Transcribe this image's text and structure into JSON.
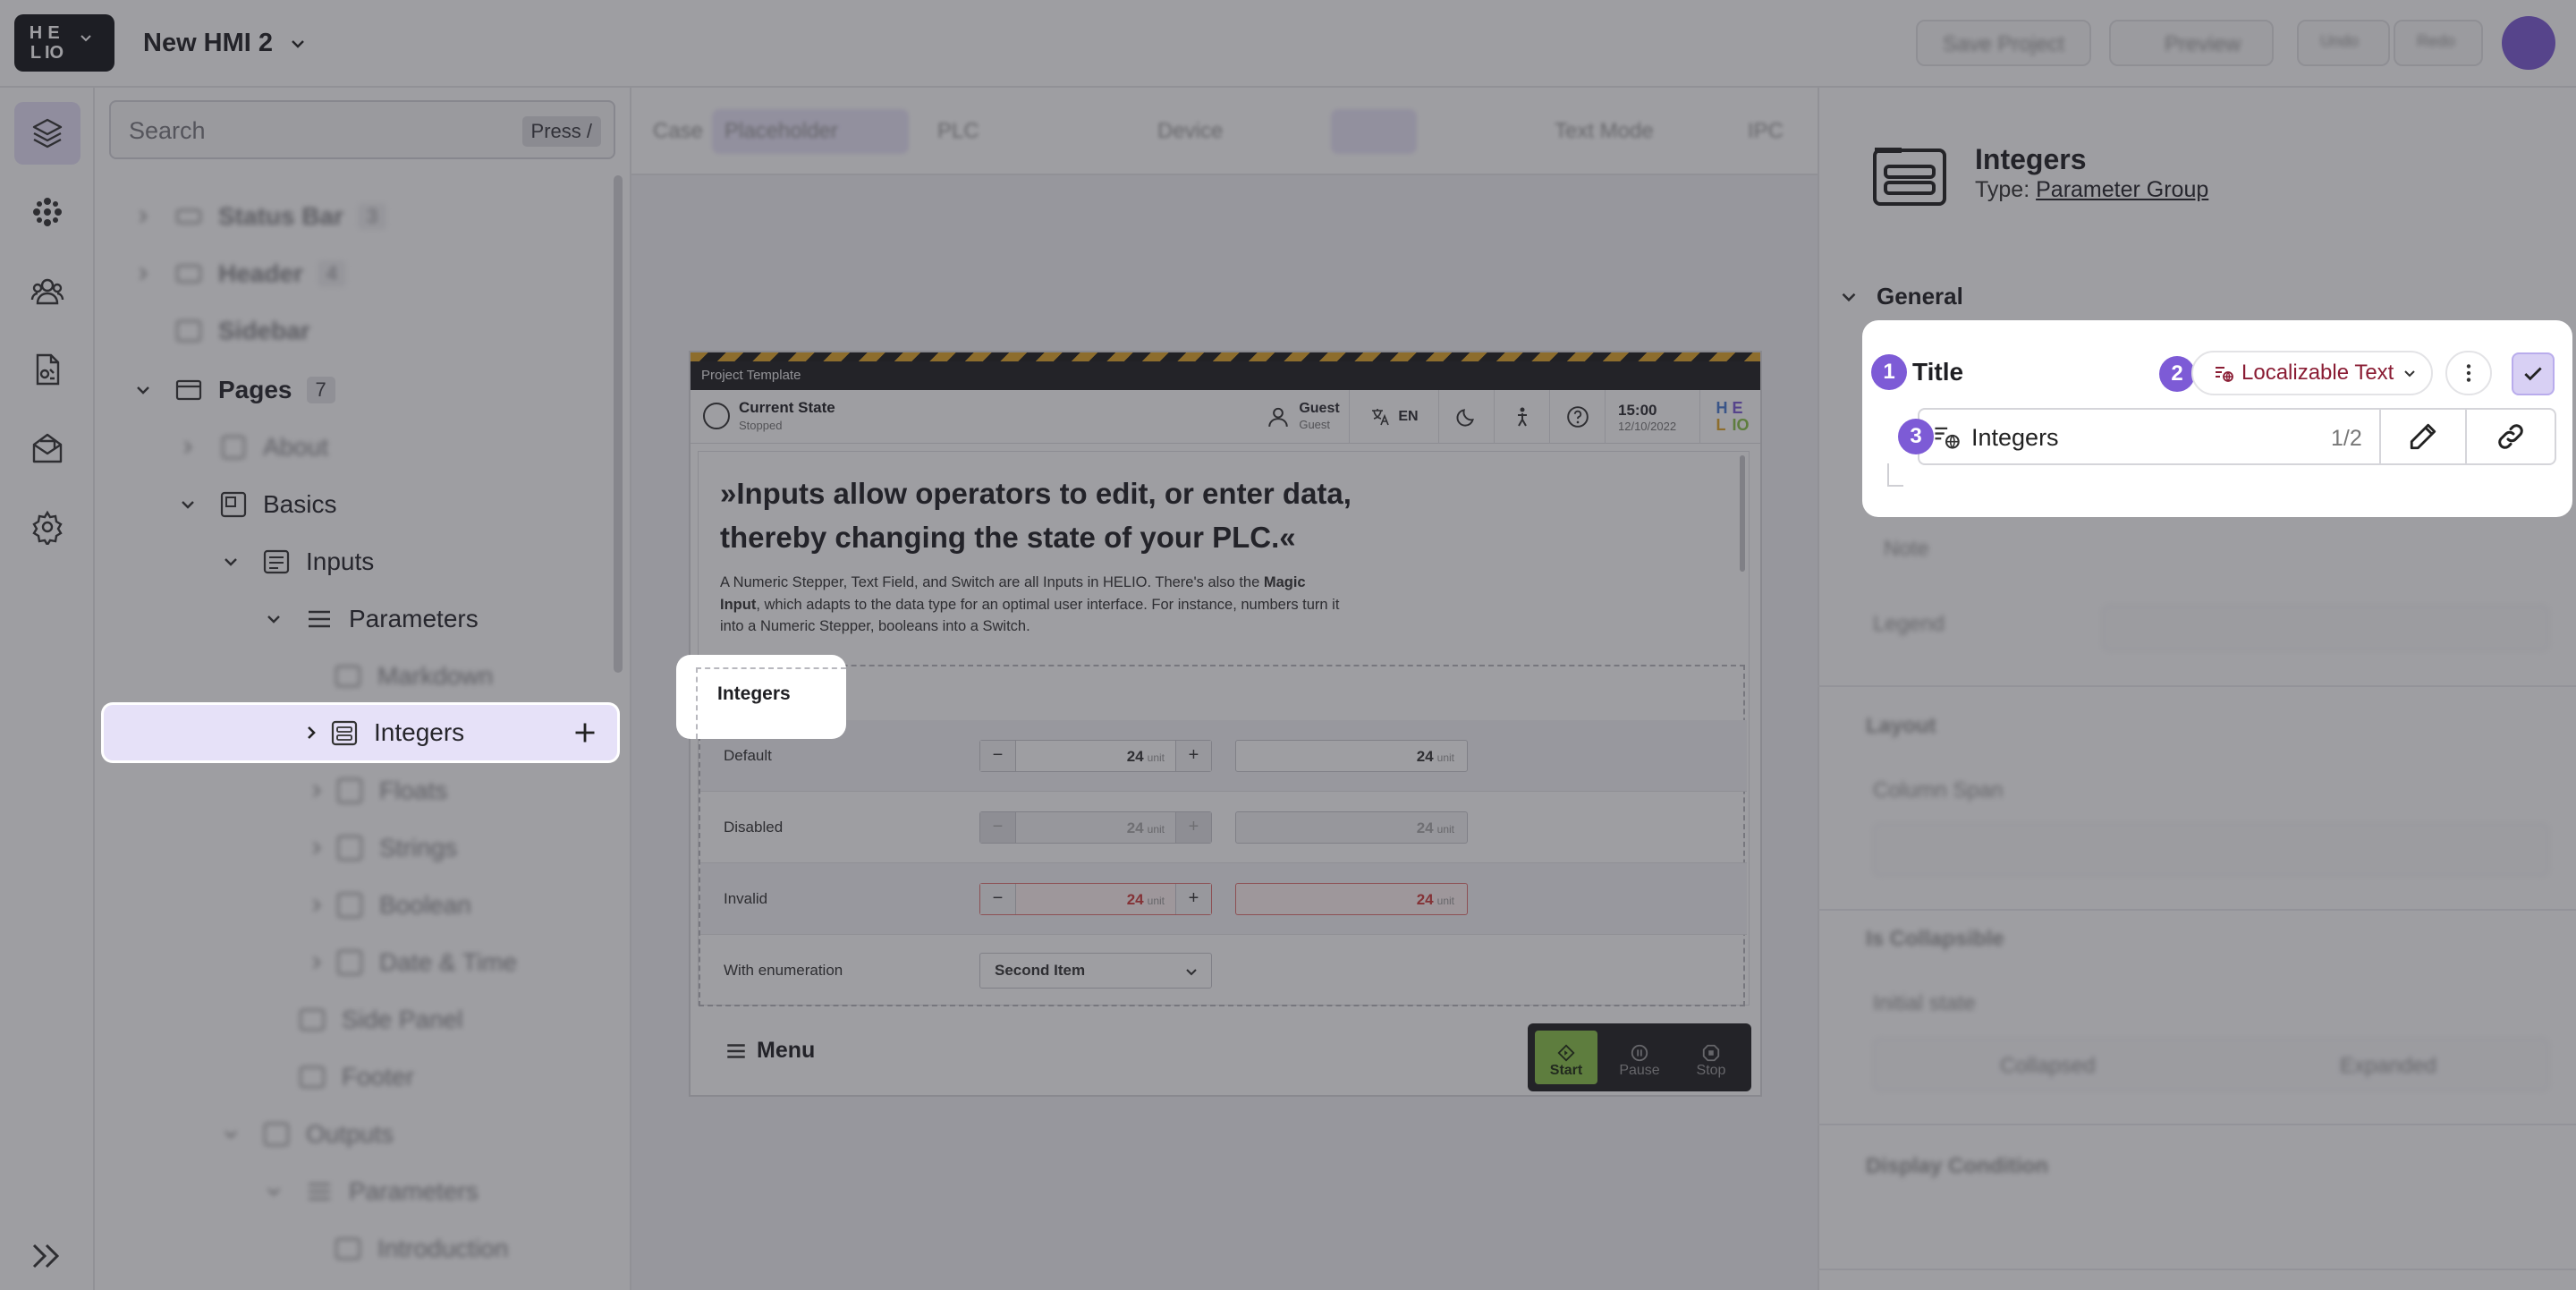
{
  "app": {
    "logo_letters": [
      "H",
      "E",
      "L",
      "IO"
    ],
    "project_name": "New HMI 2"
  },
  "topbar": {
    "right_buttons": [
      "Save Project",
      "Preview",
      "Undo",
      "Redo"
    ]
  },
  "rail": {
    "items": [
      {
        "name": "layers-icon"
      },
      {
        "name": "components-icon"
      },
      {
        "name": "users-icon"
      },
      {
        "name": "document-icon"
      },
      {
        "name": "mail-icon"
      },
      {
        "name": "settings-icon"
      }
    ]
  },
  "tree": {
    "search_placeholder": "Search",
    "search_hint": "Press /",
    "rows": [
      {
        "label": "Status Bar",
        "count": "3"
      },
      {
        "label": "Header",
        "count": "4"
      },
      {
        "label": "Sidebar"
      },
      {
        "label": "Pages",
        "count": "7"
      },
      {
        "label": "About"
      },
      {
        "label": "Basics"
      },
      {
        "label": "Inputs"
      },
      {
        "label": "Parameters"
      },
      {
        "label": "Markdown"
      },
      {
        "label": "Integers"
      },
      {
        "label": "Floats"
      },
      {
        "label": "Strings"
      },
      {
        "label": "Boolean"
      },
      {
        "label": "Date & Time"
      },
      {
        "label": "Side Panel"
      },
      {
        "label": "Footer"
      },
      {
        "label": "Outputs"
      },
      {
        "label": "Parameters"
      },
      {
        "label": "Introduction"
      }
    ]
  },
  "canvas_toolbar": {
    "items": [
      "Case",
      "Placeholder",
      "PLC",
      "Device",
      "Text Mode",
      "IPC"
    ]
  },
  "hmi": {
    "template_title": "Project Template",
    "state_label": "Current State",
    "state_value": "Stopped",
    "user_name": "Guest",
    "user_role": "Guest",
    "language": "EN",
    "time": "15:00",
    "date": "12/10/2022",
    "quote": "»Inputs allow operators to edit, or enter data, thereby changing the state of your PLC.«",
    "desc_part1": "A Numeric Stepper, Text Field, and Switch are all Inputs in HELIO. There's also the ",
    "desc_bold": "Magic Input",
    "desc_part2": ", which adapts to the data type for an optimal user interface. For instance, numbers turn it into a Numeric Stepper, booleans into a Switch.",
    "group_title": "Integers",
    "rows": [
      {
        "label": "Default",
        "value": "24",
        "unit": "unit"
      },
      {
        "label": "Disabled",
        "value": "24",
        "unit": "unit"
      },
      {
        "label": "Invalid",
        "value": "24",
        "unit": "unit"
      },
      {
        "label": "With enumeration",
        "select": "Second Item"
      }
    ],
    "menu_label": "Menu",
    "actions": {
      "start": "Start",
      "pause": "Pause",
      "stop": "Stop"
    }
  },
  "props": {
    "title": "Integers",
    "type_label": "Type:",
    "type_value": "Parameter Group",
    "section_general": "General",
    "field_title": "Title",
    "mode_label": "Localizable Text",
    "value": "Integers",
    "value_count": "1/2",
    "steps": [
      "1",
      "2",
      "3"
    ],
    "blur_labels": [
      "Note",
      "Layout",
      "Column Span",
      "Legend",
      "Is Collapsible",
      "Initial state",
      "Collapsed",
      "Expanded",
      "Display Condition"
    ]
  },
  "colors": {
    "accent": "#7d5bd6",
    "selection": "#e6e1f8",
    "start_green": "#8bc34a"
  }
}
